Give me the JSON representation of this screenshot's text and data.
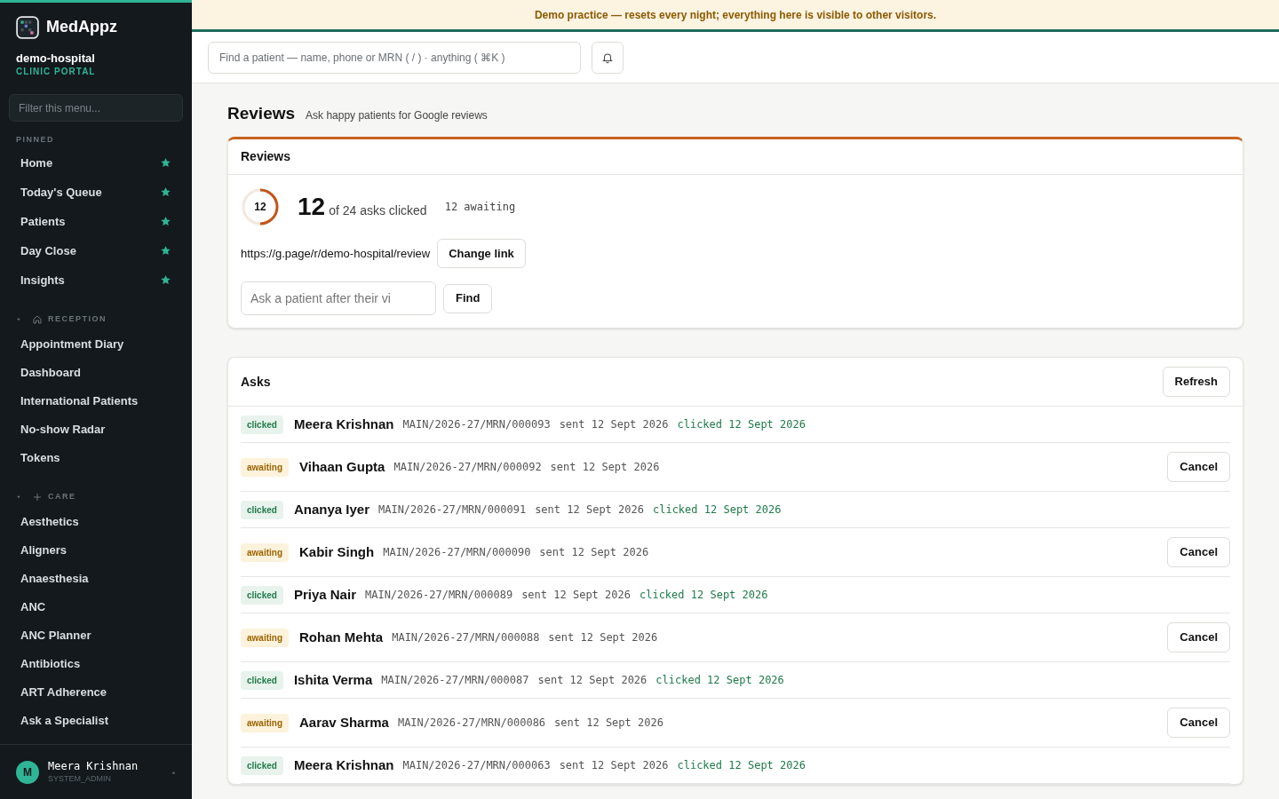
{
  "brand": {
    "name": "MedAppz",
    "org": "demo-hospital",
    "portal": "CLINIC PORTAL"
  },
  "sidebar": {
    "filter": {
      "placeholder": "Filter this menu..."
    },
    "pinned": {
      "label": "PINNED",
      "items": [
        {
          "label": "Home",
          "starred": true
        },
        {
          "label": "Today's Queue",
          "starred": true
        },
        {
          "label": "Patients",
          "starred": true
        },
        {
          "label": "Day Close",
          "starred": true
        },
        {
          "label": "Insights",
          "starred": true
        }
      ]
    },
    "groups": [
      {
        "label": "RECEPTION",
        "expanded": true,
        "items": [
          "Appointment Diary",
          "Dashboard",
          "International Patients",
          "No-show Radar",
          "Tokens"
        ]
      },
      {
        "label": "CARE",
        "expanded": true,
        "items": [
          "Aesthetics",
          "Aligners",
          "Anaesthesia",
          "ANC",
          "ANC Planner",
          "Antibiotics",
          "ART Adherence",
          "Ask a Specialist"
        ]
      }
    ],
    "user": {
      "initial": "M",
      "name": "Meera Krishnan",
      "role": "SYSTEM_ADMIN"
    }
  },
  "banner": "Demo practice — resets every night; everything here is visible to other visitors.",
  "search": {
    "placeholder": "Find a patient — name, phone or MRN ( / ) · anything ( ⌘K )"
  },
  "page": {
    "title": "Reviews",
    "subtitle": "Ask happy patients for Google reviews"
  },
  "reviews_card": {
    "title": "Reviews",
    "ring_label": "12",
    "level": 0.5,
    "count": "12",
    "count_text": "of 24 asks clicked",
    "awaiting": "12 awaiting",
    "link": "https://g.page/r/demo-hospital/review",
    "change_button": "Change link",
    "ask": {
      "placeholder": "Ask a patient after their vi"
    },
    "find_button": "Find"
  },
  "asks": {
    "title": "Asks",
    "refresh_button": "Refresh",
    "rows": [
      {
        "status": "clicked",
        "name": "Meera Krishnan",
        "mrn": "MAIN/2026-27/MRN/000093",
        "sent": "sent 12 Sept 2026",
        "clicked": "clicked 12 Sept 2026"
      },
      {
        "status": "awaiting",
        "name": "Vihaan Gupta",
        "mrn": "MAIN/2026-27/MRN/000092",
        "sent": "sent 12 Sept 2026",
        "action": "Cancel"
      },
      {
        "status": "clicked",
        "name": "Ananya Iyer",
        "mrn": "MAIN/2026-27/MRN/000091",
        "sent": "sent 12 Sept 2026",
        "clicked": "clicked 12 Sept 2026"
      },
      {
        "status": "awaiting",
        "name": "Kabir Singh",
        "mrn": "MAIN/2026-27/MRN/000090",
        "sent": "sent 12 Sept 2026",
        "action": "Cancel"
      },
      {
        "status": "clicked",
        "name": "Priya Nair",
        "mrn": "MAIN/2026-27/MRN/000089",
        "sent": "sent 12 Sept 2026",
        "clicked": "clicked 12 Sept 2026"
      },
      {
        "status": "awaiting",
        "name": "Rohan Mehta",
        "mrn": "MAIN/2026-27/MRN/000088",
        "sent": "sent 12 Sept 2026",
        "action": "Cancel"
      },
      {
        "status": "clicked",
        "name": "Ishita Verma",
        "mrn": "MAIN/2026-27/MRN/000087",
        "sent": "sent 12 Sept 2026",
        "clicked": "clicked 12 Sept 2026"
      },
      {
        "status": "awaiting",
        "name": "Aarav Sharma",
        "mrn": "MAIN/2026-27/MRN/000086",
        "sent": "sent 12 Sept 2026",
        "action": "Cancel"
      },
      {
        "status": "clicked",
        "name": "Meera Krishnan",
        "mrn": "MAIN/2026-27/MRN/000063",
        "sent": "sent 12 Sept 2026",
        "clicked": "clicked 12 Sept 2026"
      }
    ]
  }
}
